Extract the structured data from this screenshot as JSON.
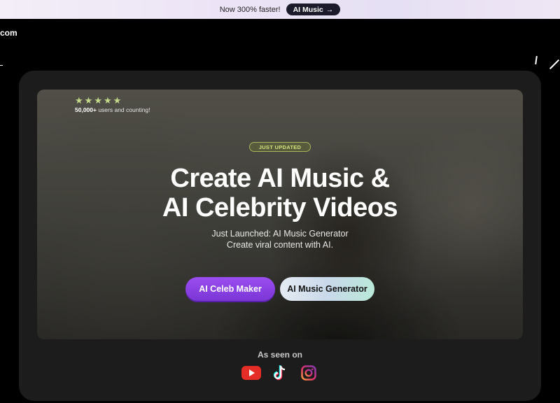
{
  "banner": {
    "text": "Now 300% faster!",
    "pill_label": "AI Music",
    "pill_arrow": "→"
  },
  "header": {
    "logo_fragment": "com"
  },
  "hero": {
    "stars": [
      "★",
      "★",
      "★",
      "★",
      "★"
    ],
    "rating_value": 5,
    "users_count": "50,000+",
    "users_suffix": " users and counting!",
    "badge": "JUST UPDATED",
    "headline_line1": "Create AI Music &",
    "headline_line2": "AI Celebrity Videos",
    "sub_line1": "Just Launched: AI Music Generator",
    "sub_line2": "Create viral content with AI.",
    "primary_button": "AI Celeb Maker",
    "secondary_button": "AI Music Generator"
  },
  "as_seen_on": {
    "label": "As seen on",
    "icons": [
      "youtube-icon",
      "tiktok-icon",
      "instagram-icon"
    ]
  },
  "colors": {
    "primary_button": "#8b42e6",
    "star": "#c5d98a",
    "badge": "#a6b65a",
    "youtube": "#e52d27"
  }
}
